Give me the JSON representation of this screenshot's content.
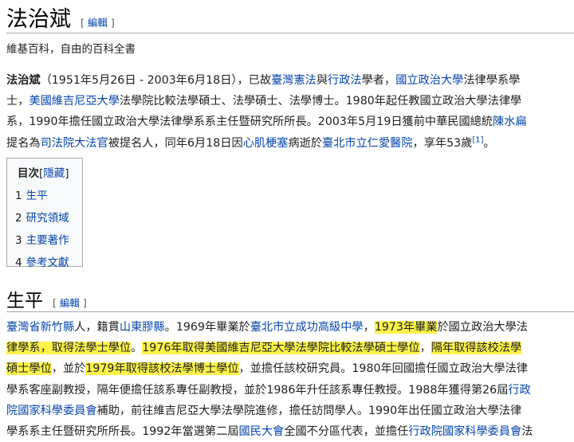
{
  "page": {
    "title": "法治斌",
    "edit_label": "編輯",
    "tagline": "維基百科，自由的百科全書"
  },
  "intro": {
    "l1": {
      "b": "法治斌",
      "t1": "（1951年5月26日 - 2003年6月18日），已故",
      "a1": "臺灣憲法",
      "t2": "與",
      "a2": "行政法",
      "t3": "學者，",
      "a3": "國立政治大學",
      "t4": "法律學系學"
    },
    "l2": {
      "t1": "士，",
      "a1": "美國維吉尼亞大學",
      "t2": "法學院比較法學碩士、法學碩士、法學博士。1980年起任教國立政治大學法律學"
    },
    "l3": {
      "t1": "系，1990年擔任國立政治大學法律學系系主任暨研究所所長。2003年5月19日獲前中華民國總統",
      "a1": "陳水扁"
    },
    "l4": {
      "t1": "提名為",
      "a1": "司法院大法官",
      "t2": "被提名人，同年6月18日因",
      "a2": "心肌梗塞",
      "t3": "病逝於",
      "a3": "臺北市立仁愛醫院",
      "t4": "，享年53歲",
      "ref": "[1]",
      "t5": "。"
    }
  },
  "toc": {
    "title": "目次",
    "toggle_open": "[",
    "toggle": "隱藏",
    "toggle_close": "]",
    "items": [
      {
        "num": "1",
        "label": "生平"
      },
      {
        "num": "2",
        "label": "研究領域"
      },
      {
        "num": "3",
        "label": "主要著作"
      },
      {
        "num": "4",
        "label": "參考文獻"
      }
    ]
  },
  "section": {
    "heading": "生平",
    "edit_label": "編輯"
  },
  "bio": {
    "l1": {
      "a1": "臺灣省新竹縣",
      "t1": "人，籍貫",
      "a2": "山東膠縣",
      "t2": "。1969年畢業於",
      "a3": "臺北市立成功高級中學",
      "t3": "，",
      "h1": "1973年畢業",
      "t4": "於國立政治大學法"
    },
    "l2": {
      "h1": "律學系，取得法學士學位",
      "t1": "。",
      "h2": "1976年取得美國維吉尼亞大學法學院比較法學碩士學位",
      "t2": "，",
      "h3": "隔年取得該校法學"
    },
    "l3": {
      "h1": "碩士學位",
      "t1": "，並於",
      "h2": "1979年取得該校法學博士學位",
      "t2": "，並擔任該校研究員。1980年回國擔任國立政治大學法律"
    },
    "l4": {
      "t1": "學系客座副教授，隔年便擔任該系專任副教授，並於1986年升任該系專任教授。1988年獲得第26屆",
      "a1": "行政"
    },
    "l5": {
      "a1": "院國家科學委員會",
      "t1": "補助，前往維吉尼亞大學法學院進修，擔任訪問學人。1990年出任國立政治大學法律"
    },
    "l6": {
      "t1": "學系系主任暨研究所所長。1992年當選第二屆",
      "a1": "國民大會",
      "t2": "全國不分區代表，並擔任",
      "a2": "行政院國家科學委員會",
      "t3": "法"
    }
  },
  "colors": {
    "link": "#0645ad",
    "highlight": "#fdf34a",
    "text": "#202122",
    "rule": "#a2a9b1"
  }
}
